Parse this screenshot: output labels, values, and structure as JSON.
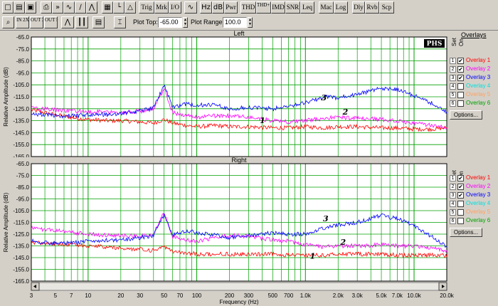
{
  "toolbar1": [
    {
      "label": "□",
      "name": "new-icon"
    },
    {
      "label": "▤",
      "name": "open-icon"
    },
    {
      "label": "▣",
      "name": "save-icon"
    },
    {
      "label": "⎙",
      "name": "print-icon"
    },
    {
      "label": "»",
      "name": "fast-forward-icon"
    },
    {
      "label": "∿",
      "name": "waveform-icon"
    },
    {
      "label": "∕",
      "name": "ramp-icon"
    },
    {
      "label": "⋀",
      "name": "peak-icon"
    },
    {
      "label": "▦",
      "name": "grid-panel-icon"
    },
    {
      "label": "└",
      "name": "axis-icon"
    },
    {
      "label": "△",
      "name": "triangle-icon"
    },
    {
      "label": "Trig",
      "name": "trig-button"
    },
    {
      "label": "Mrk",
      "name": "mrk-button"
    },
    {
      "label": "I/O",
      "name": "io-button"
    },
    {
      "label": "∿",
      "name": "sine-icon"
    },
    {
      "label": "Hz",
      "name": "hz-button"
    },
    {
      "label": "dB",
      "name": "db-button"
    },
    {
      "label": "Pwr",
      "name": "pwr-button"
    },
    {
      "label": "THD",
      "name": "thd-button"
    },
    {
      "label": "THD+N",
      "name": "thd-n-button"
    },
    {
      "label": "IMD",
      "name": "imd-button"
    },
    {
      "label": "SNR",
      "name": "snr-button"
    },
    {
      "label": "Leq",
      "name": "leq-button"
    },
    {
      "label": "Mac",
      "name": "mac-button"
    },
    {
      "label": "Log",
      "name": "log-button"
    },
    {
      "label": "Dly",
      "name": "dly-button"
    },
    {
      "label": "Rvb",
      "name": "rvb-button"
    },
    {
      "label": "Scp",
      "name": "scp-button"
    }
  ],
  "toolbar2": {
    "buttons": [
      {
        "label": "⌕",
        "name": "zoom-icon"
      },
      {
        "label": "IN 2X",
        "name": "zoom-in-2x-button"
      },
      {
        "label": "OUT 2X",
        "name": "zoom-out-2x-button"
      },
      {
        "label": "OUT FULL",
        "name": "zoom-out-full-button"
      },
      {
        "label": "⋀",
        "name": "spectrum-icon"
      },
      {
        "label": "┃┃",
        "name": "bars-icon"
      },
      {
        "label": "▤",
        "name": "table-icon"
      },
      {
        "label": "⌶",
        "name": "cursor-icon"
      }
    ],
    "plot_top_label": "Plot Top:",
    "plot_top_value": "-65.00",
    "plot_range_label": "Plot Range:",
    "plot_range_value": "100.0"
  },
  "overlays": {
    "title": "Overlays",
    "header_set": "Set",
    "header_on": "On",
    "options_label": "Options...",
    "items": [
      {
        "num": "1",
        "name": "Overlay 1",
        "color": "#ff0000",
        "left_on": true,
        "right_on": true
      },
      {
        "num": "2",
        "name": "Overlay 2",
        "color": "#ff00ff",
        "left_on": true,
        "right_on": true
      },
      {
        "num": "3",
        "name": "Overlay 3",
        "color": "#0000ff",
        "left_on": true,
        "right_on": true
      },
      {
        "num": "4",
        "name": "Overlay 4",
        "color": "#00e0e0",
        "left_on": false,
        "right_on": false
      },
      {
        "num": "5",
        "name": "Overlay 5",
        "color": "#ffa060",
        "left_on": false,
        "right_on": false
      },
      {
        "num": "6",
        "name": "Overlay 6",
        "color": "#00a000",
        "left_on": false,
        "right_on": false
      }
    ]
  },
  "colors": {
    "plot_bg": "#ffffff",
    "grid": "#00a000",
    "red": "#ff0000",
    "magenta": "#ff00ff",
    "blue": "#0000ff"
  },
  "chart_data": [
    {
      "type": "line",
      "title": "Left",
      "xlabel": "",
      "ylabel": "Relative Amplitude (dB)",
      "x_scale": "log",
      "xlim": [
        3,
        20000
      ],
      "ylim": [
        -165,
        -65
      ],
      "grid": true,
      "badge": "PHS",
      "yticks": [
        "-65.0",
        "-75.0",
        "-85.0",
        "-95.0",
        "-105.0",
        "-115.0",
        "-125.0",
        "-135.0",
        "-145.0",
        "-155.0",
        "-165.0"
      ],
      "annotations": [
        {
          "text": "3",
          "x": 1400,
          "y": -118
        },
        {
          "text": "2",
          "x": 2200,
          "y": -130
        },
        {
          "text": "1",
          "x": 380,
          "y": -137
        }
      ],
      "series": [
        {
          "name": "Overlay 1",
          "color": "#ff0000",
          "x": [
            3,
            5,
            8,
            10,
            15,
            20,
            30,
            40,
            50,
            60,
            80,
            100,
            150,
            200,
            300,
            500,
            700,
            1000,
            1500,
            2000,
            3000,
            5000,
            7000,
            10000,
            15000,
            20000
          ],
          "y": [
            -126,
            -130,
            -133,
            -134,
            -135,
            -135,
            -136,
            -137,
            -134,
            -137,
            -139,
            -140,
            -139,
            -140,
            -140,
            -141,
            -141,
            -140,
            -141,
            -140,
            -140,
            -141,
            -141,
            -142,
            -142,
            -141
          ]
        },
        {
          "name": "Overlay 2",
          "color": "#ff00ff",
          "x": [
            3,
            5,
            8,
            10,
            15,
            20,
            30,
            40,
            50,
            60,
            80,
            100,
            150,
            200,
            300,
            500,
            700,
            1000,
            1500,
            2000,
            3000,
            5000,
            7000,
            10000,
            15000,
            20000
          ],
          "y": [
            -124,
            -126,
            -127,
            -128,
            -127,
            -128,
            -127,
            -125,
            -108,
            -128,
            -131,
            -132,
            -131,
            -131,
            -132,
            -135,
            -136,
            -135,
            -133,
            -132,
            -133,
            -134,
            -135,
            -137,
            -139,
            -140
          ]
        },
        {
          "name": "Overlay 3",
          "color": "#0000ff",
          "x": [
            3,
            5,
            8,
            10,
            15,
            20,
            30,
            40,
            50,
            60,
            80,
            100,
            150,
            200,
            300,
            500,
            700,
            1000,
            1500,
            2000,
            3000,
            5000,
            7000,
            10000,
            15000,
            20000
          ],
          "y": [
            -129,
            -131,
            -131,
            -130,
            -130,
            -129,
            -127,
            -124,
            -105,
            -124,
            -121,
            -122,
            -122,
            -125,
            -124,
            -125,
            -123,
            -120,
            -115,
            -116,
            -113,
            -108,
            -109,
            -114,
            -121,
            -128
          ]
        }
      ]
    },
    {
      "type": "line",
      "title": "Right",
      "xlabel": "Frequency (Hz)",
      "ylabel": "Relative Amplitude (dB)",
      "x_scale": "log",
      "xlim": [
        3,
        20000
      ],
      "ylim": [
        -165,
        -65
      ],
      "grid": true,
      "yticks": [
        "-65.0",
        "-75.0",
        "-85.0",
        "-95.0",
        "-105.0",
        "-115.0",
        "-125.0",
        "-135.0",
        "-145.0",
        "-155.0",
        "-165.0"
      ],
      "xticks": [
        "3",
        "5",
        "7",
        "10",
        "20",
        "30",
        "50",
        "70",
        "100",
        "200",
        "300",
        "500",
        "700",
        "1.0k",
        "2.0k",
        "3.0k",
        "5.0k",
        "7.0k",
        "10.0k",
        "20.0k"
      ],
      "annotations": [
        {
          "text": "3",
          "x": 1450,
          "y": -114
        },
        {
          "text": "2",
          "x": 2100,
          "y": -134
        },
        {
          "text": "1",
          "x": 1100,
          "y": -146
        }
      ],
      "series": [
        {
          "name": "Overlay 1",
          "color": "#ff0000",
          "x": [
            3,
            5,
            8,
            10,
            15,
            20,
            30,
            40,
            50,
            60,
            80,
            100,
            150,
            200,
            300,
            500,
            700,
            1000,
            1500,
            2000,
            3000,
            5000,
            7000,
            10000,
            15000,
            20000
          ],
          "y": [
            -132,
            -133,
            -134,
            -135,
            -136,
            -137,
            -138,
            -139,
            -136,
            -140,
            -141,
            -142,
            -142,
            -142,
            -142,
            -142,
            -143,
            -143,
            -143,
            -142,
            -142,
            -142,
            -143,
            -143,
            -143,
            -143
          ]
        },
        {
          "name": "Overlay 2",
          "color": "#ff00ff",
          "x": [
            3,
            5,
            8,
            10,
            15,
            20,
            30,
            40,
            50,
            60,
            80,
            100,
            150,
            200,
            300,
            500,
            700,
            1000,
            1500,
            2000,
            3000,
            5000,
            7000,
            10000,
            15000,
            20000
          ],
          "y": [
            -120,
            -122,
            -124,
            -125,
            -126,
            -126,
            -127,
            -125,
            -106,
            -127,
            -130,
            -131,
            -128,
            -126,
            -127,
            -130,
            -131,
            -134,
            -136,
            -135,
            -135,
            -134,
            -135,
            -135,
            -137,
            -140
          ]
        },
        {
          "name": "Overlay 3",
          "color": "#0000ff",
          "x": [
            3,
            5,
            8,
            10,
            15,
            20,
            30,
            40,
            50,
            60,
            80,
            100,
            150,
            200,
            300,
            500,
            700,
            1000,
            1500,
            2000,
            3000,
            5000,
            7000,
            10000,
            15000,
            20000
          ],
          "y": [
            -131,
            -133,
            -132,
            -131,
            -130,
            -130,
            -128,
            -126,
            -108,
            -126,
            -122,
            -124,
            -126,
            -128,
            -126,
            -124,
            -125,
            -125,
            -120,
            -117,
            -115,
            -109,
            -112,
            -118,
            -128,
            -136
          ]
        }
      ]
    }
  ]
}
